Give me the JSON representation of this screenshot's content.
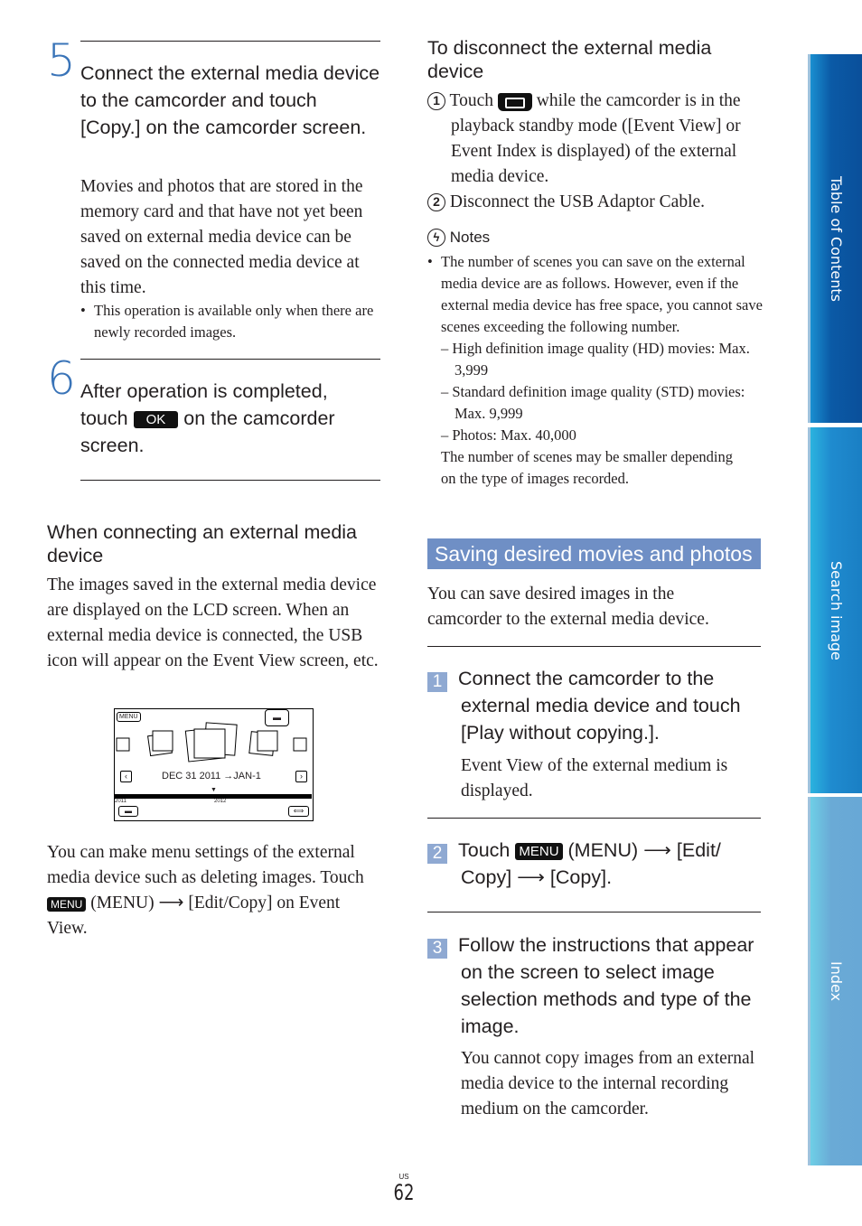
{
  "left": {
    "step5": {
      "num": "5",
      "title": "Connect the external media device to the camcorder and touch [Copy.] on the camcorder screen.",
      "body": "Movies and photos that are stored in the memory card and that have not yet been saved on external media device can be saved on the connected media device at this time.",
      "bullet": "This operation is available only when there are newly recorded images."
    },
    "step6": {
      "num": "6",
      "title_a": "After operation is completed, touch",
      "ok": "OK",
      "title_b": "on the camcorder screen."
    },
    "connecting": {
      "heading": "When connecting an external media device",
      "body": "The images saved in the external media device are displayed on the LCD screen. When an external media device is connected, the USB icon will appear on the Event View screen, etc."
    },
    "screen": {
      "menu": "MENU",
      "date": "DEC 31 2011 →JAN-1",
      "year_left": "2011",
      "year_mid": "2012"
    },
    "menu_text": {
      "a": "You can make menu settings of the external media device such as deleting images. Touch",
      "menu": "MENU",
      "b": "(MENU) ⟶ [Edit/Copy] on Event View."
    }
  },
  "right": {
    "disconnect": {
      "heading": "To disconnect the external media device",
      "s1_num": "1",
      "s1_a": "Touch",
      "s1_b": "while the camcorder is in the playback standby mode ([Event View] or Event Index is displayed) of the external media device.",
      "s2_num": "2",
      "s2": "Disconnect the USB Adaptor Cable."
    },
    "notes": {
      "label": "Notes",
      "bullet": "The number of scenes you can save on the external media device are as follows. However, even if the external media device has free space, you cannot save scenes exceeding the following number.",
      "d1": "– High definition image quality (HD) movies: Max. 3,999",
      "d2": "– Standard definition image quality (STD) movies: Max. 9,999",
      "d3": "– Photos: Max. 40,000",
      "tail": "The number of scenes may be smaller depending on the type of images recorded."
    },
    "section": {
      "title": "Saving desired movies and photos",
      "intro": "You can save desired images in the camcorder to the external media device."
    },
    "step1": {
      "num": "1",
      "title": "Connect the camcorder to the external media device and touch [Play without copying.].",
      "body": "Event View of the external medium is displayed."
    },
    "step2": {
      "num": "2",
      "a": "Touch",
      "menu": "MENU",
      "b": "(MENU) ⟶ [Edit/ Copy] ⟶ [Copy]."
    },
    "step3": {
      "num": "3",
      "title": "Follow the instructions that appear on the screen to select image selection methods and type of the image.",
      "body": "You cannot copy images from an external media device to the internal recording medium on the camcorder."
    }
  },
  "sidebar": {
    "tabs": [
      {
        "label": "Table of Contents",
        "color": "#0b5aa6"
      },
      {
        "label": "Search image",
        "color": "#1f8bcf"
      },
      {
        "label": "Index",
        "color": "#6aaad6"
      }
    ]
  },
  "footer": {
    "region": "US",
    "page": "62"
  }
}
